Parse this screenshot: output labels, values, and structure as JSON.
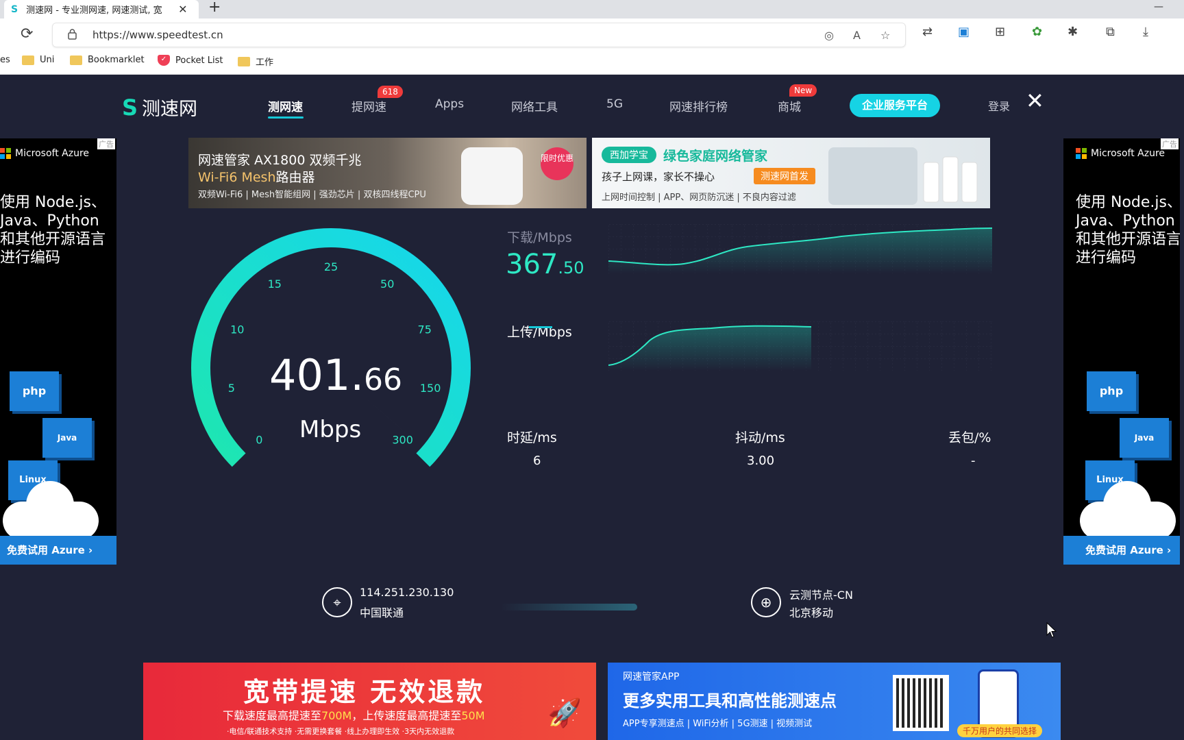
{
  "browser": {
    "tab_title": "测速网 - 专业测网速, 网速测试, 宽",
    "url": "https://www.speedtest.cn",
    "bookmarks": [
      {
        "label": "es",
        "type": "folder"
      },
      {
        "label": "Uni",
        "type": "folder"
      },
      {
        "label": "Bookmarklet",
        "type": "folder"
      },
      {
        "label": "Pocket List",
        "type": "pocket"
      },
      {
        "label": "工作",
        "type": "folder"
      }
    ]
  },
  "site": {
    "logo_text": "测速网",
    "nav": [
      {
        "label": "测网速",
        "active": true
      },
      {
        "label": "提网速",
        "badge": "618"
      },
      {
        "label": "Apps"
      },
      {
        "label": "网络工具"
      },
      {
        "label": "5G"
      },
      {
        "label": "网速排行榜"
      },
      {
        "label": "商城",
        "badge": "New"
      }
    ],
    "business_button": "企业服务平台",
    "login": "登录",
    "side_ad": {
      "brand": "Microsoft Azure",
      "ad_tag": "广告",
      "copy_left": "使用 Node.js、\nJava、Python\n和其他开源语言\n进行编码",
      "copy_right": "使用 Node.js、\nJava、Python\n和其他开源语言\n进行编码",
      "tiles": [
        "php",
        "Java",
        "Linux"
      ],
      "cta": "免费试用 Azure ›"
    },
    "banner_left": {
      "line1": "网速管家 AX1800 双频千兆",
      "line2_highlight": "Wi-Fi6 Mesh",
      "line2_rest": "路由器",
      "line3": "双频Wi-Fi6 | Mesh智能组网 | 强劲芯片 | 双核四线程CPU",
      "badge": "限时优惠"
    },
    "banner_right": {
      "tag": "西加学宝",
      "title": "绿色家庭网络管家",
      "sub": "孩子上网课，家长不操心",
      "first": "测速网首发",
      "line3": "上网时间控制 | APP、网页防沉迷 | 不良内容过滤"
    },
    "gauge": {
      "ticks": [
        "0",
        "5",
        "10",
        "15",
        "25",
        "50",
        "75",
        "150",
        "300"
      ],
      "value_int": "401.",
      "value_dec": "66",
      "unit": "Mbps",
      "current_mbps": 401.66,
      "max_mbps": 300
    },
    "download": {
      "label": "下载/Mbps",
      "value_int": "367",
      "value_dec": ".50"
    },
    "upload": {
      "label": "上传/Mbps",
      "value": ""
    },
    "latency": {
      "label": "时延/ms",
      "value": "6"
    },
    "jitter": {
      "label": "抖动/ms",
      "value": "3.00"
    },
    "packet_loss": {
      "label": "丢包/%",
      "value": "-"
    },
    "client": {
      "ip": "114.251.230.130",
      "isp": "中国联通"
    },
    "server": {
      "name": "云测节点-CN",
      "isp": "北京移动"
    },
    "bottom_left": {
      "title": "宽带提速 无效退款",
      "sub_pre": "下载速度最高提速至",
      "sub_v1": "700M",
      "sub_mid": "，上传速度最高提速至",
      "sub_v2": "50M",
      "foot": "·电信/联通技术支持   ·无需更换套餐   ·线上办理即生效   ·3天内无效退款"
    },
    "bottom_right": {
      "app": "网速管家APP",
      "title": "更多实用工具和高性能测速点",
      "sub": "APP专享测速点 | WiFi分析 | 5G测速 | 视频测试",
      "tag": "千万用户的共同选择"
    }
  },
  "colors": {
    "bg": "#1f2236",
    "accent": "#16d3e4",
    "green": "#17d9b6",
    "badge_red": "#ef3b3b"
  }
}
